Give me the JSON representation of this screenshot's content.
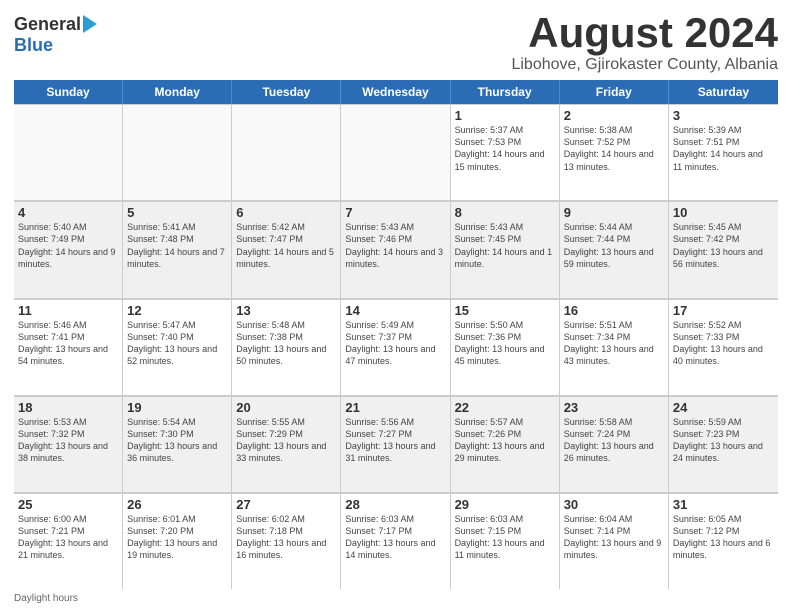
{
  "logo": {
    "general": "General",
    "blue": "Blue"
  },
  "title": "August 2024",
  "subtitle": "Libohove, Gjirokaster County, Albania",
  "days_header": [
    "Sunday",
    "Monday",
    "Tuesday",
    "Wednesday",
    "Thursday",
    "Friday",
    "Saturday"
  ],
  "weeks": [
    [
      {
        "day": "",
        "info": ""
      },
      {
        "day": "",
        "info": ""
      },
      {
        "day": "",
        "info": ""
      },
      {
        "day": "",
        "info": ""
      },
      {
        "day": "1",
        "info": "Sunrise: 5:37 AM\nSunset: 7:53 PM\nDaylight: 14 hours and 15 minutes."
      },
      {
        "day": "2",
        "info": "Sunrise: 5:38 AM\nSunset: 7:52 PM\nDaylight: 14 hours and 13 minutes."
      },
      {
        "day": "3",
        "info": "Sunrise: 5:39 AM\nSunset: 7:51 PM\nDaylight: 14 hours and 11 minutes."
      }
    ],
    [
      {
        "day": "4",
        "info": "Sunrise: 5:40 AM\nSunset: 7:49 PM\nDaylight: 14 hours and 9 minutes."
      },
      {
        "day": "5",
        "info": "Sunrise: 5:41 AM\nSunset: 7:48 PM\nDaylight: 14 hours and 7 minutes."
      },
      {
        "day": "6",
        "info": "Sunrise: 5:42 AM\nSunset: 7:47 PM\nDaylight: 14 hours and 5 minutes."
      },
      {
        "day": "7",
        "info": "Sunrise: 5:43 AM\nSunset: 7:46 PM\nDaylight: 14 hours and 3 minutes."
      },
      {
        "day": "8",
        "info": "Sunrise: 5:43 AM\nSunset: 7:45 PM\nDaylight: 14 hours and 1 minute."
      },
      {
        "day": "9",
        "info": "Sunrise: 5:44 AM\nSunset: 7:44 PM\nDaylight: 13 hours and 59 minutes."
      },
      {
        "day": "10",
        "info": "Sunrise: 5:45 AM\nSunset: 7:42 PM\nDaylight: 13 hours and 56 minutes."
      }
    ],
    [
      {
        "day": "11",
        "info": "Sunrise: 5:46 AM\nSunset: 7:41 PM\nDaylight: 13 hours and 54 minutes."
      },
      {
        "day": "12",
        "info": "Sunrise: 5:47 AM\nSunset: 7:40 PM\nDaylight: 13 hours and 52 minutes."
      },
      {
        "day": "13",
        "info": "Sunrise: 5:48 AM\nSunset: 7:38 PM\nDaylight: 13 hours and 50 minutes."
      },
      {
        "day": "14",
        "info": "Sunrise: 5:49 AM\nSunset: 7:37 PM\nDaylight: 13 hours and 47 minutes."
      },
      {
        "day": "15",
        "info": "Sunrise: 5:50 AM\nSunset: 7:36 PM\nDaylight: 13 hours and 45 minutes."
      },
      {
        "day": "16",
        "info": "Sunrise: 5:51 AM\nSunset: 7:34 PM\nDaylight: 13 hours and 43 minutes."
      },
      {
        "day": "17",
        "info": "Sunrise: 5:52 AM\nSunset: 7:33 PM\nDaylight: 13 hours and 40 minutes."
      }
    ],
    [
      {
        "day": "18",
        "info": "Sunrise: 5:53 AM\nSunset: 7:32 PM\nDaylight: 13 hours and 38 minutes."
      },
      {
        "day": "19",
        "info": "Sunrise: 5:54 AM\nSunset: 7:30 PM\nDaylight: 13 hours and 36 minutes."
      },
      {
        "day": "20",
        "info": "Sunrise: 5:55 AM\nSunset: 7:29 PM\nDaylight: 13 hours and 33 minutes."
      },
      {
        "day": "21",
        "info": "Sunrise: 5:56 AM\nSunset: 7:27 PM\nDaylight: 13 hours and 31 minutes."
      },
      {
        "day": "22",
        "info": "Sunrise: 5:57 AM\nSunset: 7:26 PM\nDaylight: 13 hours and 29 minutes."
      },
      {
        "day": "23",
        "info": "Sunrise: 5:58 AM\nSunset: 7:24 PM\nDaylight: 13 hours and 26 minutes."
      },
      {
        "day": "24",
        "info": "Sunrise: 5:59 AM\nSunset: 7:23 PM\nDaylight: 13 hours and 24 minutes."
      }
    ],
    [
      {
        "day": "25",
        "info": "Sunrise: 6:00 AM\nSunset: 7:21 PM\nDaylight: 13 hours and 21 minutes."
      },
      {
        "day": "26",
        "info": "Sunrise: 6:01 AM\nSunset: 7:20 PM\nDaylight: 13 hours and 19 minutes."
      },
      {
        "day": "27",
        "info": "Sunrise: 6:02 AM\nSunset: 7:18 PM\nDaylight: 13 hours and 16 minutes."
      },
      {
        "day": "28",
        "info": "Sunrise: 6:03 AM\nSunset: 7:17 PM\nDaylight: 13 hours and 14 minutes."
      },
      {
        "day": "29",
        "info": "Sunrise: 6:03 AM\nSunset: 7:15 PM\nDaylight: 13 hours and 11 minutes."
      },
      {
        "day": "30",
        "info": "Sunrise: 6:04 AM\nSunset: 7:14 PM\nDaylight: 13 hours and 9 minutes."
      },
      {
        "day": "31",
        "info": "Sunrise: 6:05 AM\nSunset: 7:12 PM\nDaylight: 13 hours and 6 minutes."
      }
    ]
  ],
  "footer": "Daylight hours"
}
